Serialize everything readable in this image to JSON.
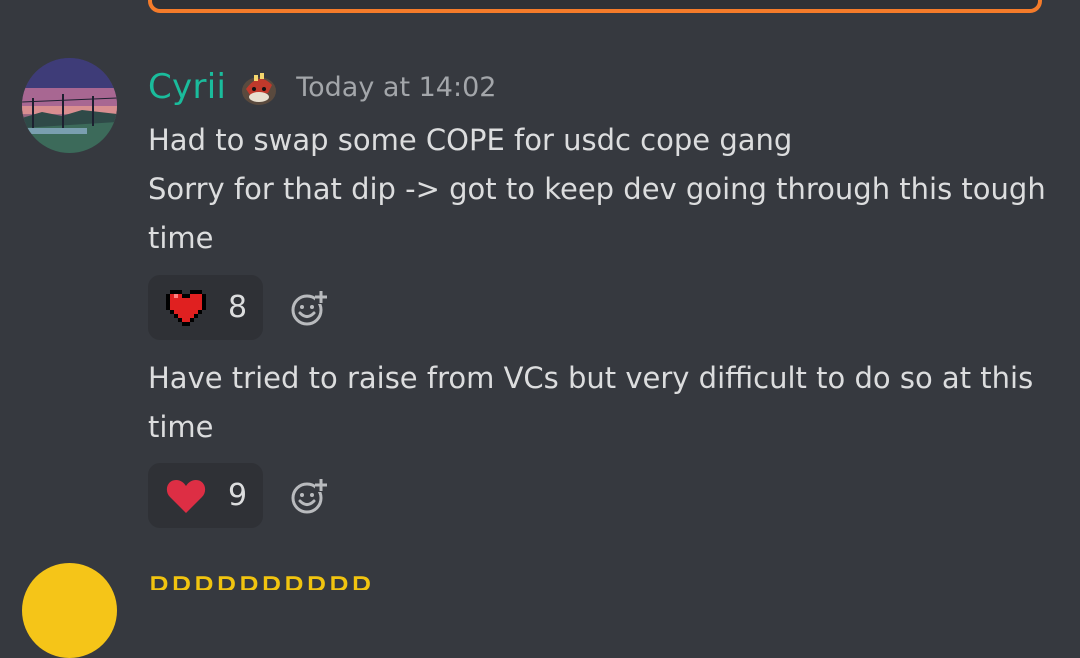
{
  "message": {
    "username": "Cyrii",
    "timestamp": "Today at 14:02",
    "paragraph1": [
      "Had to swap some COPE for usdc cope gang",
      "Sorry for that dip -> got to keep dev going through this tough",
      "time"
    ],
    "reaction1": {
      "icon": "pixel-heart-icon",
      "count": "8"
    },
    "paragraph2": [
      "Have tried to raise from VCs but very difficult to do so at this",
      "time"
    ],
    "reaction2": {
      "icon": "red-heart-icon",
      "count": "9"
    }
  },
  "next_message": {
    "username_partial": "PPPPPPPPPP"
  },
  "colors": {
    "background": "#36393f",
    "username": "#1abc9c",
    "embed_border": "#f47b2a",
    "reaction_bg": "#2f3136",
    "next_username": "#f1c40f"
  }
}
